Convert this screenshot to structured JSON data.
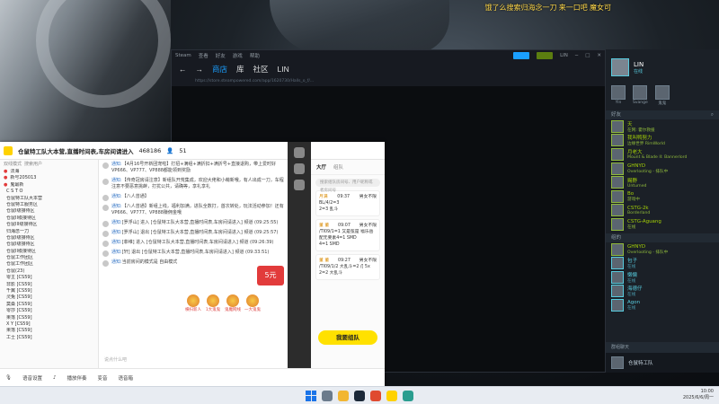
{
  "banner": {
    "text": "饿了么搜索归海念一刀 来一口吧 魔女可"
  },
  "steam": {
    "menu": [
      "Steam",
      "查看",
      "好友",
      "游戏",
      "帮助"
    ],
    "user": "LIN",
    "nav": [
      "商店",
      "库",
      "社区",
      "LIN"
    ],
    "url": "https://store.steampowered.com/app/1620730/Halls_o_f/..."
  },
  "yy": {
    "title": "仓鼠特工队大本营,直播时间表,车房间请进入",
    "room_id": "468186",
    "online": "51",
    "sidebar": {
      "top_label": "双线模式",
      "search_hint": "搜索用户",
      "rows": [
        {
          "badge": "●",
          "text": "法海"
        },
        {
          "badge": "●",
          "text": "新号205013"
        },
        {
          "badge": "●",
          "text": "鬼最新"
        },
        {
          "badge": "",
          "text": "C S T O"
        },
        {
          "badge": "",
          "text": "仓鼠特工队大本营"
        },
        {
          "badge": "",
          "text": "仓鼠特工服务区"
        },
        {
          "badge": "",
          "text": "仓鼠I级接待区"
        },
        {
          "badge": "",
          "text": "仓鼠II级接待区"
        },
        {
          "badge": "",
          "text": "仓鼠III级接待区"
        },
        {
          "badge": "",
          "text": "归海念一刀"
        },
        {
          "badge": "",
          "text": "仓鼠I级接待区"
        },
        {
          "badge": "",
          "text": "仓鼠I级接待区"
        },
        {
          "badge": "",
          "text": "仓鼠II级接待区"
        },
        {
          "badge": "",
          "text": "仓鼠工作团区"
        },
        {
          "badge": "",
          "text": "仓鼠工作团区"
        },
        {
          "badge": "",
          "text": "仓鼠(23)"
        },
        {
          "badge": "",
          "text": "零主 [CS59]"
        },
        {
          "badge": "",
          "text": "非影 [CS59]"
        },
        {
          "badge": "",
          "text": "千翼 [CS59]"
        },
        {
          "badge": "",
          "text": "灵兔 [CS59]"
        },
        {
          "badge": "",
          "text": "莫桑 [CS59]"
        },
        {
          "badge": "",
          "text": "零莎 [CS59]"
        },
        {
          "badge": "",
          "text": "果落 [CS59]"
        },
        {
          "badge": "",
          "text": "X Y [CS59]"
        },
        {
          "badge": "",
          "text": "果落 [CS59]"
        },
        {
          "badge": "",
          "text": "工士 [CS59]"
        }
      ]
    },
    "chat": [
      {
        "who": "通知:",
        "text": "【4月16号开新团宠啦】打招+满组+满折扣+满折号+直接退购，带上爱时好VP666、VP777、VP888都能领到奖励"
      },
      {
        "who": "通知:",
        "text": "【传奇冠房请注意】新组队开荒集成，欢迎大佬和小萌新哦，有人出成一刀，车程注意不要恶意挑衅，打扰公共，请确等，享礼享礼"
      },
      {
        "who": "通知:",
        "text": "【八人曾通】"
      },
      {
        "who": "通知:",
        "text": "【八人曾通】新组上线，福利加满，进队全数打，首次转处，玩法活动参加！还有VP666、VP777、VP888赚佣金哦"
      },
      {
        "who": "通知:",
        "text": "[罗浮山] 进入 [仓鼠特工队大本营,直播时间表,车房间请进入] 频道 (09:25:55)"
      },
      {
        "who": "通知:",
        "text": "[罗浮山] 退出 [仓鼠特工队大本营,直播时间表,车房间请进入] 频道 (09:25:57)"
      },
      {
        "who": "通知:",
        "text": "[菲维] 进入 [仓鼠特工队大本营,直播时间表,车房间请进入] 频道 (09:26:39)"
      },
      {
        "who": "通知:",
        "text": "[轩] 退出 [仓鼠特工队大本营,直播时间表,车房间请进入] 频道 (09:33:51)"
      },
      {
        "who": "通知:",
        "text": "当前房间的模式是 自由模式"
      }
    ],
    "input_placeholder": "说点什么吧",
    "red_pack": "5元",
    "gifts": [
      "横扫新人",
      "1大鬼鬼",
      "鬼魔网线",
      "一大鬼鬼"
    ],
    "panel": {
      "tabs": [
        "大厅",
        "组队"
      ],
      "search": "搜索组队房间号、用户昵称或者房间号",
      "cards": [
        {
          "name": "月满",
          "time": "09:37",
          "tag": "男女不限",
          "line1": "BL/4/2=3",
          "line2": "2=3  乱斗"
        },
        {
          "name": "董 董",
          "time": "09:07",
          "tag": "男女不限",
          "line1": "/TI09/1=1 又是弦是 福乐岳配无要素4=1 SMD",
          "line2": "4=1  SMD"
        },
        {
          "name": "董 董",
          "time": "09:27",
          "tag": "男女不限",
          "line1": "/TI09/1/2 大乱斗=2 /[ 5x",
          "line2": "2=2  大乱斗"
        }
      ],
      "team_button": "我要组队"
    },
    "bottom": [
      "语音设置",
      "播放伴奏",
      "变音",
      "语音箱"
    ]
  },
  "friends": {
    "user_name": "LIN",
    "user_status": "在线",
    "recent": [
      "Yln",
      "Svange",
      "鬼鬼"
    ],
    "section_friends": "好友",
    "friends": [
      {
        "name": "天",
        "status": "在网: 霍尔救援",
        "online": false
      },
      {
        "name": "我叫鸭努力",
        "status": "边缘世界 RimWorld",
        "online": false
      },
      {
        "name": "月老大",
        "status": "Mount & Blade II: Bannerlord",
        "online": false
      },
      {
        "name": "GHNYD",
        "status": "Overlooting - 排队中",
        "online": false
      },
      {
        "name": "赐野",
        "status": "Unturned",
        "online": false
      },
      {
        "name": "Bo",
        "status": "游戏中",
        "online": false
      },
      {
        "name": "CSTG-2k",
        "status": "Borderland",
        "online": false
      },
      {
        "name": "CSTG-Aguang",
        "status": "在线",
        "online": false
      }
    ],
    "section_group": "组的",
    "group": [
      {
        "name": "GHNYD",
        "status": "Overlooting - 排队中",
        "online": false
      },
      {
        "name": "包子",
        "status": "在线",
        "online": true
      },
      {
        "name": "懒懒",
        "status": "在线",
        "online": true
      },
      {
        "name": "海德仔",
        "status": "在线",
        "online": true
      },
      {
        "name": "Agon",
        "status": "在线",
        "online": true
      }
    ],
    "group_chat_label": "群组聊天",
    "group_chat_name": "仓鼠特工队"
  },
  "taskbar": {
    "time": "10:00",
    "date": "2025/6/6/周一"
  },
  "colors": {
    "steam_blue": "#1a9fff",
    "online": "#57cbde",
    "ingame": "#90ba3c",
    "yy_yellow": "#ffe100"
  }
}
